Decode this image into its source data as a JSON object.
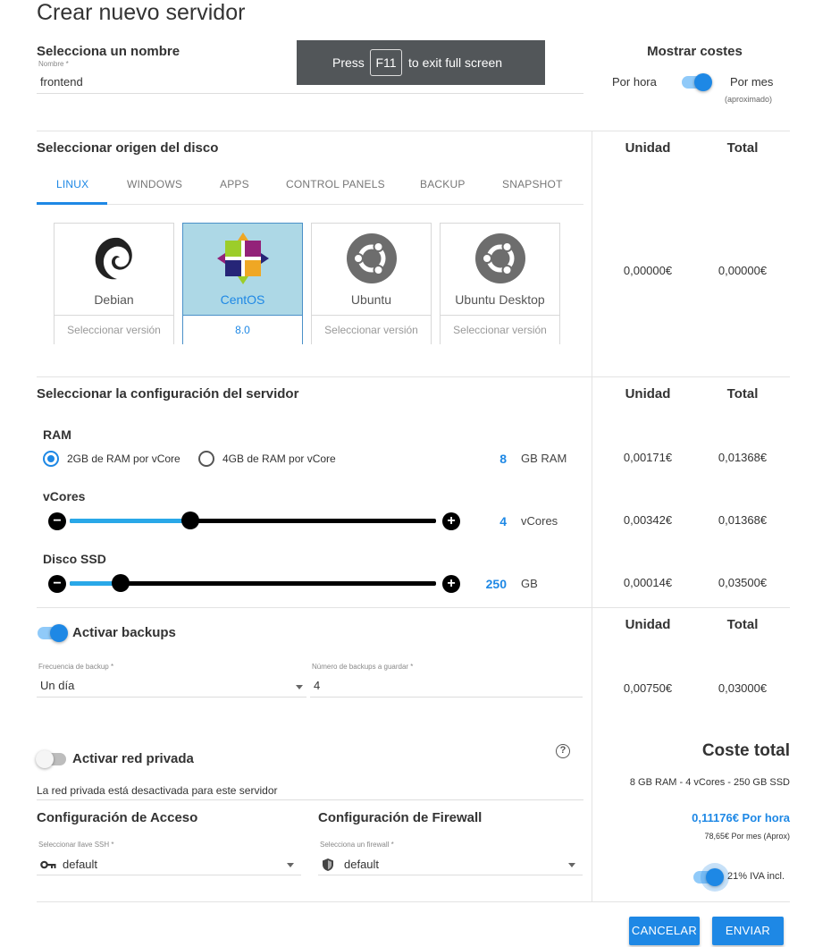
{
  "page": {
    "title": "Crear nuevo servidor"
  },
  "fullscreen_toast": {
    "press": "Press",
    "key": "F11",
    "rest": "to exit full screen"
  },
  "name_section": {
    "title": "Selecciona un nombre",
    "field_label": "Nombre *",
    "value": "frontend"
  },
  "costs_toggle": {
    "title": "Mostrar costes",
    "left": "Por hora",
    "right": "Por mes",
    "right_note": "(aproximado)",
    "state": "por hora"
  },
  "disk_section": {
    "title": "Seleccionar origen del disco",
    "tabs": [
      "LINUX",
      "WINDOWS",
      "APPS",
      "CONTROL PANELS",
      "BACKUP",
      "SNAPSHOT"
    ],
    "active_tab": "LINUX",
    "cards": [
      {
        "name": "Debian",
        "version": "Seleccionar versión",
        "icon": "debian-swirl-icon"
      },
      {
        "name": "CentOS",
        "version": "8.0",
        "icon": "centos-icon"
      },
      {
        "name": "Ubuntu",
        "version": "Seleccionar versión",
        "icon": "ubuntu-circle-icon"
      },
      {
        "name": "Ubuntu Desktop",
        "version": "Seleccionar versión",
        "icon": "ubuntu-circle-icon"
      }
    ],
    "selected_card": "CentOS",
    "unit_header": "Unidad",
    "total_header": "Total",
    "unit_cost": "0,00000€",
    "total_cost": "0,00000€"
  },
  "config_section": {
    "title": "Seleccionar la configuración del servidor",
    "unit_header": "Unidad",
    "total_header": "Total",
    "ram": {
      "label": "RAM",
      "options": [
        "2GB de RAM por vCore",
        "4GB de RAM por vCore"
      ],
      "selected": "2GB de RAM por vCore",
      "value": "8",
      "unit": "GB RAM",
      "unit_cost": "0,00171€",
      "total_cost": "0,01368€"
    },
    "vcores": {
      "label": "vCores",
      "value": "4",
      "unit": "vCores",
      "slider_fraction": 0.33,
      "unit_cost": "0,00342€",
      "total_cost": "0,01368€"
    },
    "ssd": {
      "label": "Disco SSD",
      "value": "250",
      "unit": "GB",
      "slider_fraction": 0.14,
      "unit_cost": "0,00014€",
      "total_cost": "0,03500€"
    },
    "minus": "−",
    "plus": "+"
  },
  "backup_section": {
    "toggle_label": "Activar backups",
    "enabled": true,
    "unit_header": "Unidad",
    "total_header": "Total",
    "frequency_label": "Frecuencia de backup *",
    "frequency_value": "Un día",
    "count_label": "Número de backups a guardar *",
    "count_value": "4",
    "unit_cost": "0,00750€",
    "total_cost": "0,03000€"
  },
  "private_network": {
    "toggle_label": "Activar red privada",
    "enabled": false,
    "help": "?",
    "status": "La red privada está desactivada para este servidor"
  },
  "access_section": {
    "title": "Configuración de Acceso",
    "field_label": "Seleccionar llave SSH *",
    "value": "default",
    "icon": "key-icon"
  },
  "firewall_section": {
    "title": "Configuración de Firewall",
    "field_label": "Selecciona un firewall *",
    "value": "default",
    "icon": "shield-icon"
  },
  "total_cost": {
    "title": "Coste total",
    "summary": "8 GB RAM - 4 vCores - 250 GB SSD",
    "hourly": "0,11176€ Por hora",
    "monthly": "78,65€ Por mes (Aprox)",
    "vat_label": "21% IVA incl.",
    "vat_enabled": true
  },
  "actions": {
    "cancel": "CANCELAR",
    "submit": "ENVIAR"
  },
  "colors": {
    "accent": "#1e88e5",
    "slider_fill": "#29a8e8",
    "selected_card": "#add8e6",
    "toast_bg": "#525659"
  }
}
